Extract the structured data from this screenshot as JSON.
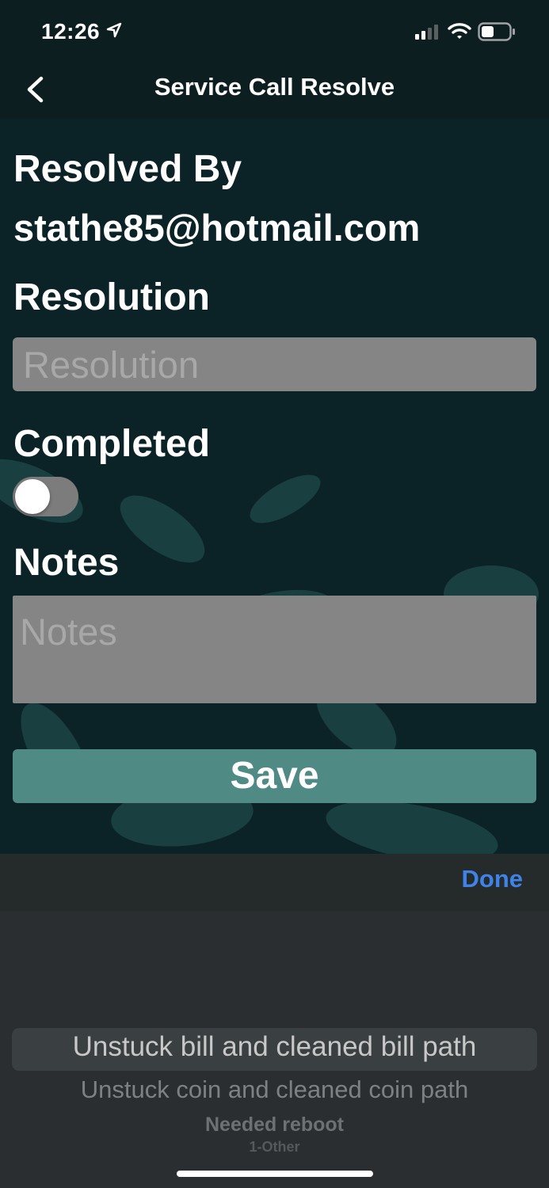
{
  "status_bar": {
    "time": "12:26"
  },
  "nav": {
    "title": "Service Call Resolve"
  },
  "form": {
    "resolved_by_label": "Resolved By",
    "resolved_by_value": "stathe85@hotmail.com",
    "resolution_label": "Resolution",
    "resolution_placeholder": "Resolution",
    "completed_label": "Completed",
    "completed_on": false,
    "notes_label": "Notes",
    "notes_placeholder": "Notes",
    "save_label": "Save"
  },
  "keyboard_toolbar": {
    "done_label": "Done"
  },
  "picker": {
    "options": [
      "Unstuck bill and cleaned bill path",
      "Unstuck coin and cleaned coin path",
      "Needed reboot",
      "1-Other"
    ],
    "selected_index": 0
  },
  "colors": {
    "accent": "#4f8b84",
    "link": "#3f82e8",
    "background": "#0b2326",
    "field": "#858585"
  },
  "icons": [
    "location-arrow-icon",
    "signal-icon",
    "wifi-icon",
    "battery-icon",
    "back-chevron-icon"
  ]
}
